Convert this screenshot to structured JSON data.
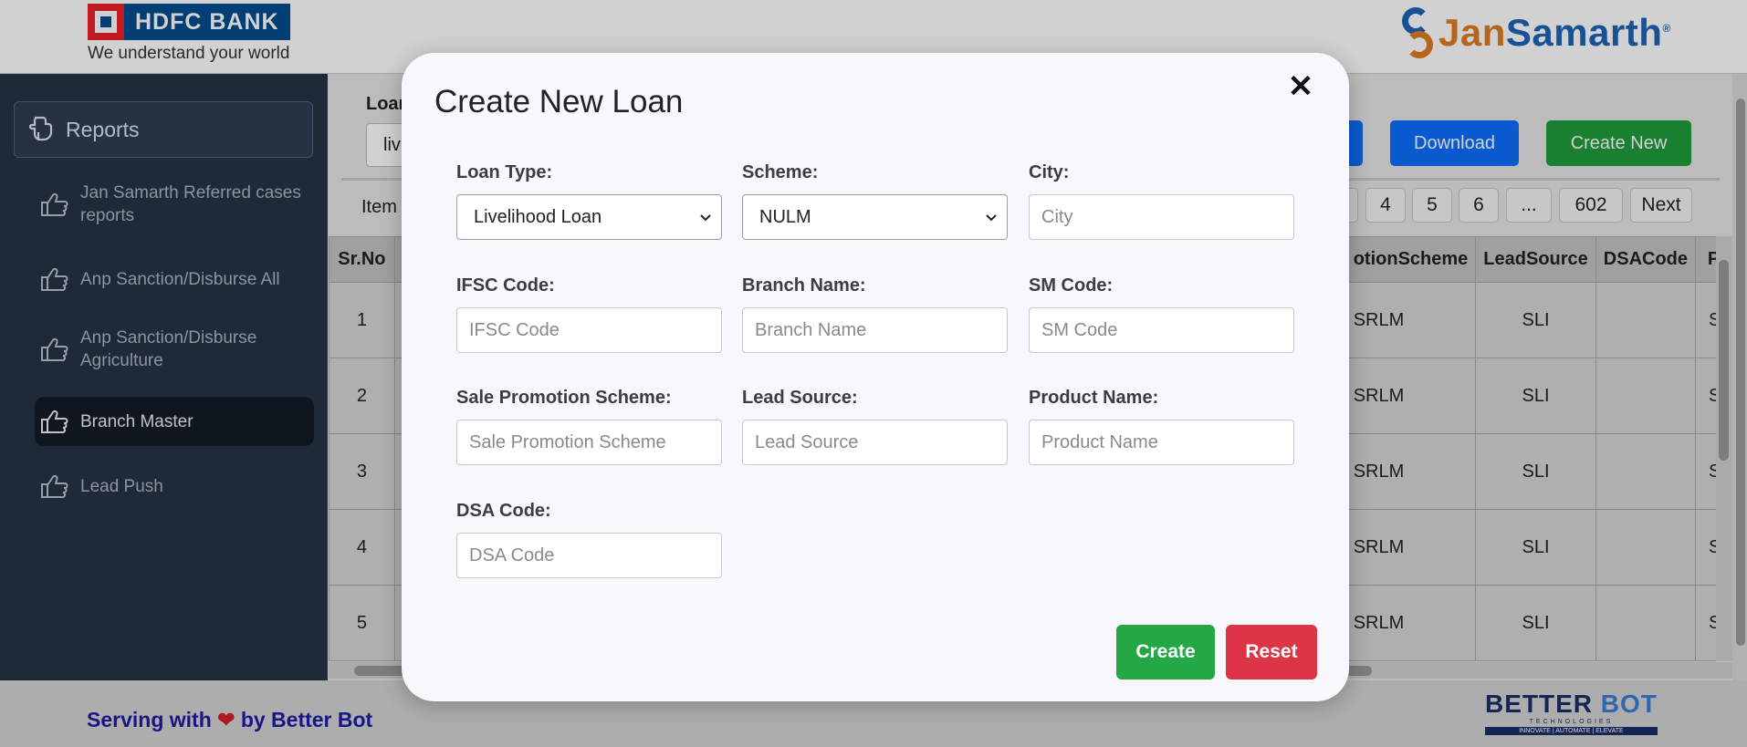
{
  "header": {
    "bank_name": "HDFC BANK",
    "bank_tagline": "We understand your world",
    "partner_part1": "Jan",
    "partner_part2": "Samarth",
    "partner_mark": "®"
  },
  "sidebar": {
    "reports_label": "Reports",
    "items": [
      {
        "label": "Jan Samarth Referred cases reports"
      },
      {
        "label": "Anp Sanction/Disburse All"
      },
      {
        "label": "Anp Sanction/Disburse Agriculture"
      },
      {
        "label": "Branch Master"
      },
      {
        "label": "Lead Push"
      }
    ]
  },
  "main": {
    "filter_label": "Loan",
    "filter_value": "liv",
    "items_label": "Item",
    "download_label": "Download",
    "create_new_label": "Create New",
    "pagination": [
      "4",
      "5",
      "6",
      "...",
      "602",
      "Next"
    ],
    "table": {
      "headers": [
        "Sr.No",
        "otionScheme",
        "LeadSource",
        "DSACode",
        "P"
      ],
      "rows": [
        [
          "1",
          "SRLM",
          "SLI",
          "",
          "Se"
        ],
        [
          "2",
          "SRLM",
          "SLI",
          "",
          "Se"
        ],
        [
          "3",
          "SRLM",
          "SLI",
          "",
          "Se"
        ],
        [
          "4",
          "SRLM",
          "SLI",
          "",
          "Se"
        ],
        [
          "5",
          "SRLM",
          "SLI",
          "",
          "Se"
        ]
      ]
    }
  },
  "modal": {
    "title": "Create New Loan",
    "close_symbol": "✕",
    "loan_type": {
      "label": "Loan Type:",
      "value": "Livelihood Loan"
    },
    "scheme": {
      "label": "Scheme:",
      "value": "NULM"
    },
    "city": {
      "label": "City:",
      "placeholder": "City"
    },
    "ifsc": {
      "label": "IFSC Code:",
      "placeholder": "IFSC Code"
    },
    "branch_name": {
      "label": "Branch Name:",
      "placeholder": "Branch Name"
    },
    "sm_code": {
      "label": "SM Code:",
      "placeholder": "SM Code"
    },
    "sale_promotion": {
      "label": "Sale Promotion Scheme:",
      "placeholder": "Sale Promotion Scheme"
    },
    "lead_source": {
      "label": "Lead Source:",
      "placeholder": "Lead Source"
    },
    "product_name": {
      "label": "Product Name:",
      "placeholder": "Product Name"
    },
    "dsa_code": {
      "label": "DSA Code:",
      "placeholder": "DSA Code"
    },
    "create_label": "Create",
    "reset_label": "Reset"
  },
  "footer": {
    "text_before": "Serving with",
    "heart": "❤",
    "text_after": "by Better Bot",
    "logo_part1": "BETTER ",
    "logo_part2": "BOT",
    "logo_sub": "TECHNOLOGIES",
    "logo_bar": "INNOVATE | AUTOMATE | ELEVATE"
  },
  "colors": {
    "sidebar_bg": "#273445",
    "download_btn": "#0d6efd",
    "create_new_btn": "#1f9d3c",
    "create_btn": "#23a845",
    "reset_btn": "#dc3545"
  }
}
